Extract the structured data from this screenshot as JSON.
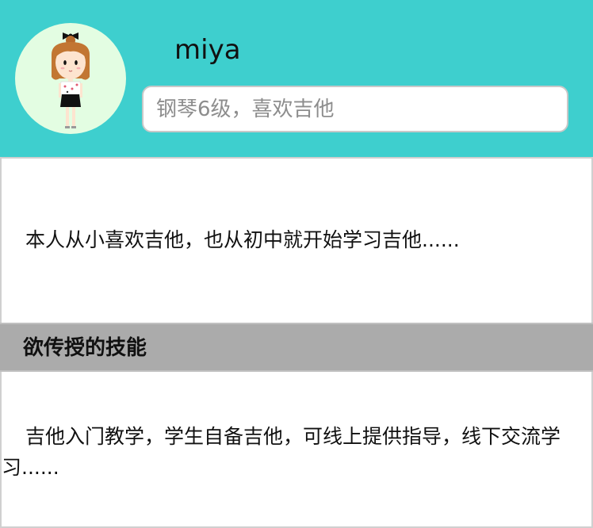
{
  "profile": {
    "username": "miya",
    "bio_placeholder": "钢琴6级，喜欢吉他",
    "bio_value": "",
    "avatar_icon": "cartoon-girl-avatar-icon"
  },
  "intro": {
    "text": "本人从小喜欢吉他，也从初中就开始学习吉他......"
  },
  "skills": {
    "section_title": "欲传授的技能",
    "text": "吉他入门教学，学生自备吉他，可线上提供指导，线下交流学习......"
  },
  "colors": {
    "header_bg": "#3ecfce",
    "avatar_bg": "#e3fde2",
    "section_header_bg": "#ababab"
  }
}
